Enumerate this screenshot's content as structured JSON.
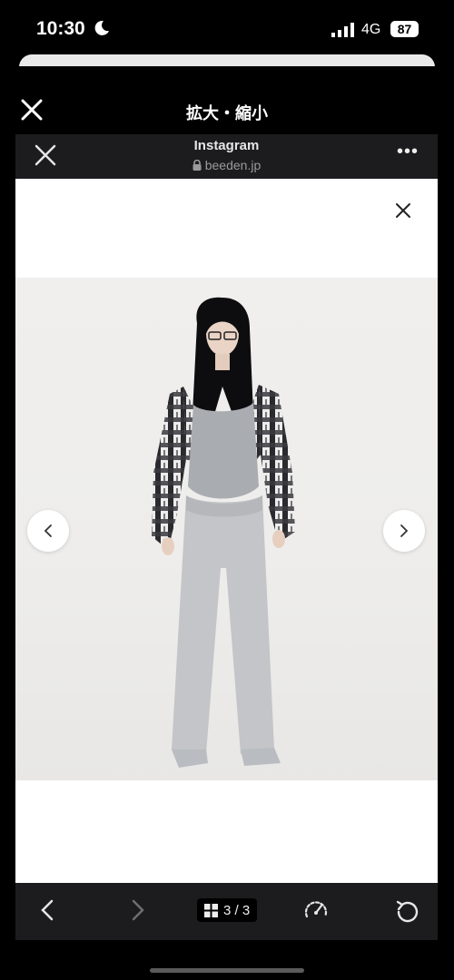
{
  "status_bar": {
    "time": "10:30",
    "network": "4G",
    "battery": "87"
  },
  "header": {
    "title": "拡大・縮小"
  },
  "browser": {
    "title": "Instagram",
    "url": "beeden.jp"
  },
  "toolbar": {
    "page_indicator": "3 / 3"
  },
  "icons": [
    "moon-icon",
    "signal-icon",
    "close-icon",
    "lock-icon",
    "more-icon",
    "chevron-left-icon",
    "chevron-right-icon",
    "grid-icon",
    "speedometer-icon",
    "reload-icon"
  ]
}
